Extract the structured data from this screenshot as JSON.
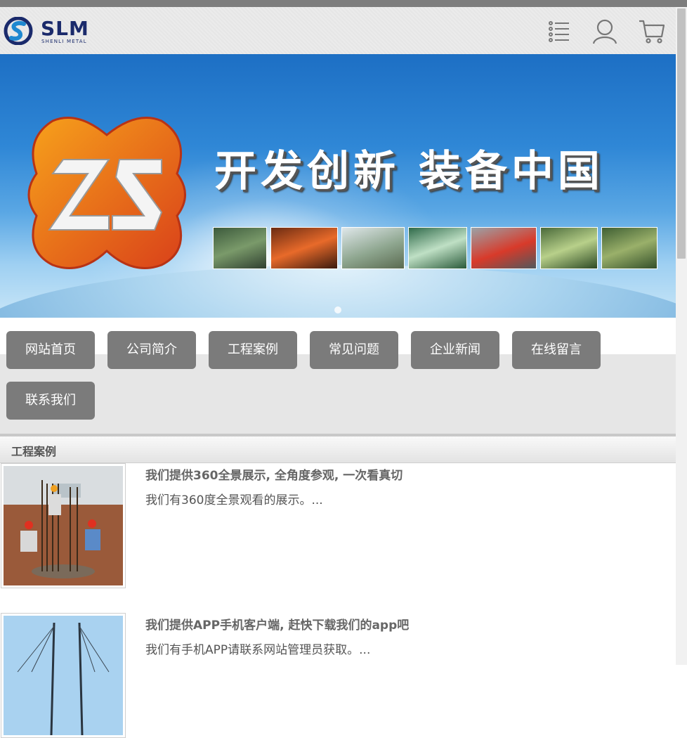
{
  "header": {
    "logo_text": "SLM",
    "logo_sub": "SHENLI METAL",
    "icons": [
      "menu-list-icon",
      "user-icon",
      "cart-icon"
    ]
  },
  "banner": {
    "slogan": "开发创新  装备中国",
    "logo_letters": "ZS"
  },
  "nav": {
    "items": [
      {
        "label": "网站首页"
      },
      {
        "label": "公司简介"
      },
      {
        "label": "工程案例"
      },
      {
        "label": "常见问题"
      },
      {
        "label": "企业新闻"
      },
      {
        "label": "在线留言"
      },
      {
        "label": "联系我们"
      }
    ]
  },
  "section": {
    "title": "工程案例"
  },
  "cases": [
    {
      "title": "我们提供360全景展示, 全角度参观, 一次看真切",
      "desc": "我们有360度全景观看的展示。..."
    },
    {
      "title": "我们提供APP手机客户端, 赶快下载我们的app吧",
      "desc": "我们有手机APP请联系网站管理员获取。..."
    }
  ],
  "colors": {
    "nav_button": "#7b7b7b",
    "logo_blue": "#1a2a6b",
    "banner_blue": "#2f87d6"
  }
}
